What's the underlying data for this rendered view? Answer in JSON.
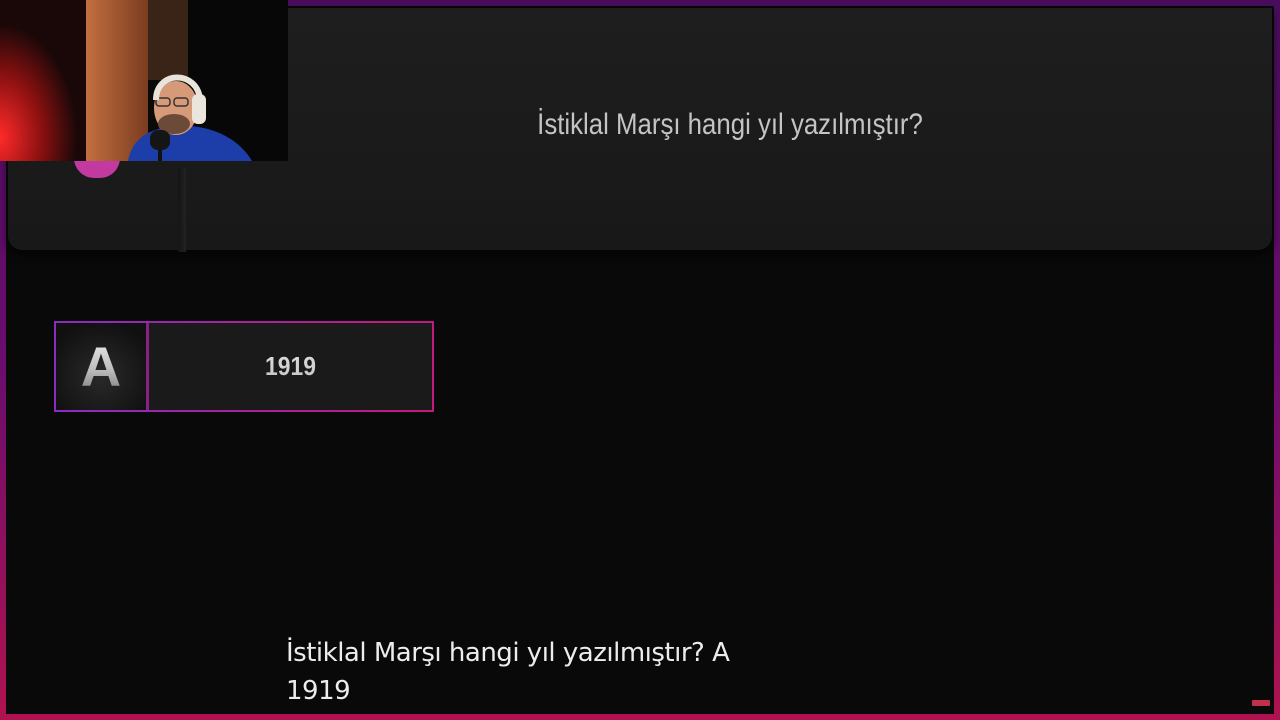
{
  "question": {
    "text": "İstiklal Marşı hangi yıl yazılmıştır?"
  },
  "answers": [
    {
      "letter": "A",
      "value": "1919"
    }
  ],
  "caption": {
    "line1": "İstiklal Marşı hangi yıl yazılmıştır? A",
    "line2": "1919"
  },
  "colors": {
    "frame_top": "#4a0d5e",
    "frame_bottom": "#b0124f",
    "card_border_left": "#8a2cc0",
    "card_border_right": "#c21a7e",
    "panel": "#1e1e1e",
    "background": "#090909"
  },
  "icons": {
    "streamer_cam": "webcam-feed"
  }
}
